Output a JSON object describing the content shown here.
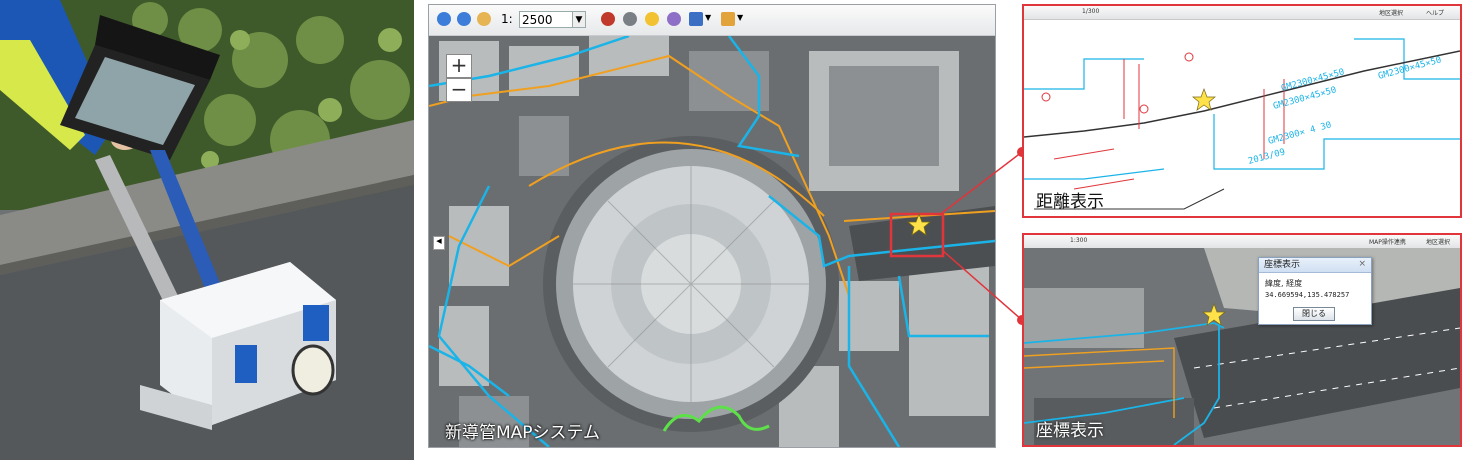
{
  "main_map": {
    "scale_prefix": "1:",
    "scale_value": "2500",
    "zoom_in_label": "+",
    "zoom_out_label": "−",
    "caption": "新導管MAPシステム"
  },
  "inset_distance": {
    "caption": "距離表示",
    "toolbar_scale": "1/300",
    "toolbar_right_1": "地区選択",
    "toolbar_right_2": "ヘルプ",
    "pipe_labels": [
      "GM2300×45×50",
      "GM2300×45×50",
      "GM2300×45×50",
      "GM2300× 4 30",
      "2013/09"
    ]
  },
  "inset_coordinate": {
    "caption": "座標表示",
    "toolbar_scale": "1:300",
    "toolbar_right_1": "MAP操作連携",
    "toolbar_right_2": "地区選択",
    "dialog": {
      "title": "座標表示",
      "close": "×",
      "label": "緯度, 経度",
      "value": "34.669594,135.478257",
      "button": "閉じる"
    }
  },
  "colors": {
    "accent_red": "#e0353b",
    "pipe_cyan": "#1ab4e8",
    "pipe_orange": "#f0a020",
    "pipe_green": "#5ee04a",
    "marker_yellow": "#ffe14a"
  }
}
